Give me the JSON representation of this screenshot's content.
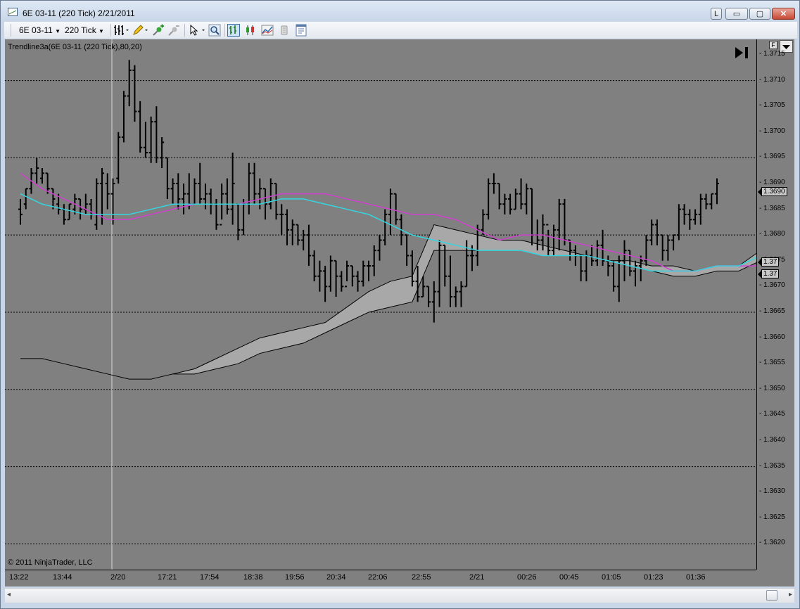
{
  "window": {
    "title": "6E 03-11 (220 Tick)  2/21/2011",
    "link_button": "L",
    "minimize_glyph": "▭",
    "maximize_glyph": "▢",
    "close_glyph": "✕"
  },
  "toolbar": {
    "instrument": "6E 03-11",
    "interval": "220 Tick",
    "icons": [
      "bars-style-icon",
      "pencil-draw-icon",
      "add-indicator-icon",
      "remove-indicator-icon",
      "cursor-icon",
      "zoom-icon",
      "bar-chart-icon",
      "candlestick-icon",
      "line-chart-icon",
      "data-box-icon",
      "properties-icon"
    ]
  },
  "chart": {
    "indicator_label": "Trendline3a(6E 03-11 (220 Tick),80,20)",
    "copyright": "© 2011 NinjaTrader, LLC",
    "f_button": "F",
    "colors": {
      "background": "#808080",
      "cyan": "#33d6e0",
      "magenta": "#d040d0",
      "cloud": "#a8a8a8"
    },
    "price_tags": [
      "1.3690",
      "1.37",
      "1.37"
    ]
  },
  "chart_data": {
    "type": "line",
    "ylim": [
      1.3615,
      1.3718
    ],
    "y_ticks": [
      "1.3715",
      "1.3710",
      "1.3705",
      "1.3700",
      "1.3695",
      "1.3690",
      "1.3685",
      "1.3680",
      "1.3675",
      "1.3670",
      "1.3665",
      "1.3660",
      "1.3655",
      "1.3650",
      "1.3645",
      "1.3640",
      "1.3635",
      "1.3630",
      "1.3625",
      "1.3620"
    ],
    "x_ticks": [
      "13:22",
      "13:44",
      "2/20",
      "17:21",
      "17:54",
      "18:38",
      "19:56",
      "20:34",
      "22:06",
      "22:55",
      "2/21",
      "00:26",
      "00:45",
      "01:05",
      "01:23",
      "01:36"
    ],
    "grid_lines": [
      1.371,
      1.3695,
      1.368,
      1.3665,
      1.365,
      1.3635,
      1.362
    ],
    "bars": [
      [
        1.3687,
        1.3682,
        1.3685,
        1.3684
      ],
      [
        1.3689,
        1.3685,
        1.3686,
        1.3689
      ],
      [
        1.3693,
        1.3688,
        1.3689,
        1.3692
      ],
      [
        1.3695,
        1.369,
        1.3692,
        1.3693
      ],
      [
        1.3693,
        1.369,
        1.3691,
        1.3692
      ],
      [
        1.3692,
        1.3688,
        1.3692,
        1.3689
      ],
      [
        1.3689,
        1.3685,
        1.3689,
        1.3687
      ],
      [
        1.3688,
        1.3684,
        1.3686,
        1.3685
      ],
      [
        1.3686,
        1.3682,
        1.3685,
        1.3683
      ],
      [
        1.3686,
        1.3683,
        1.3683,
        1.3686
      ],
      [
        1.3688,
        1.3684,
        1.3685,
        1.3687
      ],
      [
        1.3687,
        1.3683,
        1.3687,
        1.3685
      ],
      [
        1.3688,
        1.3684,
        1.3685,
        1.3686
      ],
      [
        1.3687,
        1.3683,
        1.3686,
        1.3684
      ],
      [
        1.3691,
        1.3681,
        1.3682,
        1.369
      ],
      [
        1.3693,
        1.3682,
        1.369,
        1.3692
      ],
      [
        1.3692,
        1.3685,
        1.369,
        1.3688
      ],
      [
        1.3691,
        1.3682,
        1.3688,
        1.369
      ],
      [
        1.37,
        1.369,
        1.3691,
        1.3699
      ],
      [
        1.3708,
        1.3698,
        1.3699,
        1.3707
      ],
      [
        1.3714,
        1.3705,
        1.3707,
        1.3712
      ],
      [
        1.3713,
        1.3702,
        1.3712,
        1.3704
      ],
      [
        1.3706,
        1.3696,
        1.3704,
        1.3697
      ],
      [
        1.3702,
        1.3695,
        1.3697,
        1.3696
      ],
      [
        1.3703,
        1.3694,
        1.3696,
        1.3702
      ],
      [
        1.3705,
        1.3694,
        1.3702,
        1.3695
      ],
      [
        1.3699,
        1.3693,
        1.3695,
        1.3698
      ],
      [
        1.3695,
        1.3687,
        1.3695,
        1.3689
      ],
      [
        1.3691,
        1.3686,
        1.3689,
        1.369
      ],
      [
        1.3692,
        1.3685,
        1.369,
        1.3687
      ],
      [
        1.369,
        1.3684,
        1.3687,
        1.3688
      ],
      [
        1.3692,
        1.3685,
        1.3688,
        1.3686
      ],
      [
        1.3691,
        1.3686,
        1.3686,
        1.369
      ],
      [
        1.3694,
        1.3686,
        1.369,
        1.3687
      ],
      [
        1.369,
        1.3685,
        1.3687,
        1.3688
      ],
      [
        1.3689,
        1.3684,
        1.3688,
        1.3686
      ],
      [
        1.3687,
        1.3681,
        1.3686,
        1.3682
      ],
      [
        1.369,
        1.3683,
        1.3682,
        1.3688
      ],
      [
        1.3691,
        1.3684,
        1.3688,
        1.3685
      ],
      [
        1.3696,
        1.3682,
        1.3685,
        1.369
      ],
      [
        1.3686,
        1.3679,
        1.3686,
        1.3681
      ],
      [
        1.3687,
        1.368,
        1.3681,
        1.3686
      ],
      [
        1.3694,
        1.3684,
        1.3686,
        1.3692
      ],
      [
        1.3694,
        1.3686,
        1.3692,
        1.3688
      ],
      [
        1.3691,
        1.3685,
        1.3688,
        1.3689
      ],
      [
        1.3689,
        1.3683,
        1.3689,
        1.3686
      ],
      [
        1.3691,
        1.3685,
        1.3686,
        1.369
      ],
      [
        1.369,
        1.3683,
        1.369,
        1.3684
      ],
      [
        1.3686,
        1.368,
        1.3684,
        1.3684
      ],
      [
        1.3685,
        1.3678,
        1.3684,
        1.3681
      ],
      [
        1.3683,
        1.3678,
        1.3681,
        1.3682
      ],
      [
        1.3682,
        1.3678,
        1.3682,
        1.3679
      ],
      [
        1.3681,
        1.3677,
        1.3679,
        1.368
      ],
      [
        1.3682,
        1.3674,
        1.368,
        1.3676
      ],
      [
        1.3677,
        1.3671,
        1.3676,
        1.3672
      ],
      [
        1.3675,
        1.3669,
        1.3672,
        1.3673
      ],
      [
        1.3674,
        1.3667,
        1.3673,
        1.367
      ],
      [
        1.3676,
        1.3669,
        1.367,
        1.3675
      ],
      [
        1.3675,
        1.3668,
        1.3675,
        1.3672
      ],
      [
        1.3673,
        1.3669,
        1.3672,
        1.367
      ],
      [
        1.3675,
        1.3671,
        1.367,
        1.3674
      ],
      [
        1.3674,
        1.367,
        1.3674,
        1.3672
      ],
      [
        1.3673,
        1.3669,
        1.3672,
        1.3671
      ],
      [
        1.3675,
        1.367,
        1.3671,
        1.3674
      ],
      [
        1.3675,
        1.3671,
        1.3674,
        1.3674
      ],
      [
        1.3678,
        1.3672,
        1.3674,
        1.3677
      ],
      [
        1.368,
        1.3675,
        1.3677,
        1.3679
      ],
      [
        1.3685,
        1.3678,
        1.3679,
        1.3684
      ],
      [
        1.3689,
        1.368,
        1.3684,
        1.3688
      ],
      [
        1.3688,
        1.3682,
        1.3688,
        1.3683
      ],
      [
        1.3684,
        1.3678,
        1.3683,
        1.368
      ],
      [
        1.368,
        1.3674,
        1.368,
        1.3676
      ],
      [
        1.3677,
        1.367,
        1.3676,
        1.3671
      ],
      [
        1.3674,
        1.3667,
        1.3671,
        1.3668
      ],
      [
        1.3672,
        1.3668,
        1.3668,
        1.367
      ],
      [
        1.367,
        1.3666,
        1.367,
        1.3667
      ],
      [
        1.3671,
        1.3663,
        1.3667,
        1.3669
      ],
      [
        1.3679,
        1.3666,
        1.3669,
        1.3678
      ],
      [
        1.3678,
        1.367,
        1.3678,
        1.3672
      ],
      [
        1.3676,
        1.3666,
        1.3672,
        1.3668
      ],
      [
        1.367,
        1.3666,
        1.3668,
        1.3669
      ],
      [
        1.3671,
        1.3666,
        1.3669,
        1.367
      ],
      [
        1.3679,
        1.367,
        1.367,
        1.3676
      ],
      [
        1.3678,
        1.3673,
        1.3676,
        1.3676
      ],
      [
        1.3682,
        1.3674,
        1.3676,
        1.3681
      ],
      [
        1.3685,
        1.368,
        1.3681,
        1.3684
      ],
      [
        1.3691,
        1.3683,
        1.3684,
        1.369
      ],
      [
        1.3692,
        1.3688,
        1.369,
        1.369
      ],
      [
        1.369,
        1.3685,
        1.369,
        1.3686
      ],
      [
        1.3688,
        1.3684,
        1.3686,
        1.3687
      ],
      [
        1.3688,
        1.3684,
        1.3687,
        1.3685
      ],
      [
        1.3689,
        1.3685,
        1.3685,
        1.3688
      ],
      [
        1.3691,
        1.3685,
        1.3688,
        1.3686
      ],
      [
        1.369,
        1.3684,
        1.3686,
        1.3689
      ],
      [
        1.3689,
        1.3678,
        1.3689,
        1.368
      ],
      [
        1.3683,
        1.3677,
        1.368,
        1.3679
      ],
      [
        1.3684,
        1.3677,
        1.3679,
        1.3682
      ],
      [
        1.3681,
        1.3676,
        1.3682,
        1.3677
      ],
      [
        1.3682,
        1.3676,
        1.3677,
        1.3681
      ],
      [
        1.3687,
        1.3677,
        1.3681,
        1.3686
      ],
      [
        1.3687,
        1.3678,
        1.3686,
        1.3679
      ],
      [
        1.3679,
        1.3675,
        1.3679,
        1.3677
      ],
      [
        1.3678,
        1.3674,
        1.3677,
        1.3676
      ],
      [
        1.3676,
        1.3671,
        1.3676,
        1.3673
      ],
      [
        1.3677,
        1.3671,
        1.3673,
        1.3676
      ],
      [
        1.3678,
        1.3674,
        1.3676,
        1.3675
      ],
      [
        1.3679,
        1.3674,
        1.3675,
        1.3678
      ],
      [
        1.3681,
        1.3674,
        1.3678,
        1.3675
      ],
      [
        1.3676,
        1.3672,
        1.3675,
        1.3674
      ],
      [
        1.3675,
        1.3669,
        1.3674,
        1.367
      ],
      [
        1.3676,
        1.3667,
        1.367,
        1.3675
      ],
      [
        1.3679,
        1.3671,
        1.3675,
        1.3677
      ],
      [
        1.3677,
        1.3672,
        1.3677,
        1.3673
      ],
      [
        1.3675,
        1.367,
        1.3673,
        1.3674
      ],
      [
        1.3676,
        1.3671,
        1.3674,
        1.3675
      ],
      [
        1.368,
        1.3674,
        1.3675,
        1.3679
      ],
      [
        1.3683,
        1.3678,
        1.3679,
        1.3682
      ],
      [
        1.3683,
        1.3678,
        1.3682,
        1.368
      ],
      [
        1.368,
        1.3675,
        1.368,
        1.3677
      ],
      [
        1.368,
        1.3675,
        1.3677,
        1.3679
      ],
      [
        1.368,
        1.3677,
        1.3679,
        1.368
      ],
      [
        1.3686,
        1.3679,
        1.368,
        1.3685
      ],
      [
        1.3686,
        1.3682,
        1.3685,
        1.3684
      ],
      [
        1.3685,
        1.3681,
        1.3684,
        1.3683
      ],
      [
        1.3685,
        1.3682,
        1.3683,
        1.3684
      ],
      [
        1.3688,
        1.3682,
        1.3684,
        1.3687
      ],
      [
        1.3688,
        1.3685,
        1.3687,
        1.3686
      ],
      [
        1.3688,
        1.3685,
        1.3686,
        1.3688
      ],
      [
        1.3691,
        1.3686,
        1.3688,
        1.369
      ]
    ],
    "series": [
      {
        "color": "magenta",
        "x": [
          0,
          4,
          8,
          12,
          16,
          20,
          24,
          28,
          32,
          36,
          40,
          44,
          48,
          52,
          56,
          60,
          64,
          68,
          72,
          76,
          80,
          84,
          88,
          92,
          96,
          100,
          104,
          108,
          112,
          116,
          120,
          124,
          128,
          132,
          136
        ],
        "y": [
          1.3692,
          1.3689,
          1.3687,
          1.3685,
          1.3683,
          1.3683,
          1.3684,
          1.3685,
          1.3686,
          1.3686,
          1.3686,
          1.3687,
          1.3688,
          1.3688,
          1.3688,
          1.3687,
          1.3686,
          1.3685,
          1.3684,
          1.3684,
          1.3683,
          1.3681,
          1.3679,
          1.368,
          1.368,
          1.3679,
          1.3678,
          1.3677,
          1.3676,
          1.3675,
          1.3673,
          1.3673,
          1.3674,
          1.3674,
          1.3674
        ]
      },
      {
        "color": "cyan",
        "x": [
          0,
          4,
          8,
          12,
          16,
          20,
          24,
          28,
          32,
          36,
          40,
          44,
          48,
          52,
          56,
          60,
          64,
          68,
          72,
          76,
          80,
          84,
          88,
          92,
          96,
          100,
          104,
          108,
          112,
          116,
          120,
          124,
          128,
          132,
          136
        ],
        "y": [
          1.3688,
          1.3686,
          1.3685,
          1.3684,
          1.3684,
          1.3684,
          1.3685,
          1.3686,
          1.3686,
          1.3686,
          1.3686,
          1.3686,
          1.3687,
          1.3687,
          1.3686,
          1.3685,
          1.3684,
          1.3682,
          1.368,
          1.3679,
          1.3678,
          1.3677,
          1.3677,
          1.3677,
          1.3676,
          1.3676,
          1.3676,
          1.3675,
          1.3674,
          1.3673,
          1.3673,
          1.3673,
          1.3674,
          1.3674,
          1.3676
        ]
      }
    ],
    "cloud_upper": [
      1.3656,
      1.3656,
      1.3655,
      1.3654,
      1.3653,
      1.3652,
      1.3652,
      1.3653,
      1.3654,
      1.3656,
      1.3658,
      1.366,
      1.3661,
      1.3662,
      1.3663,
      1.3666,
      1.3669,
      1.3671,
      1.3672,
      1.3682,
      1.3681,
      1.368,
      1.3679,
      1.3679,
      1.3678,
      1.3677,
      1.3676,
      1.3675,
      1.3675,
      1.3674,
      1.3674,
      1.3673,
      1.3674,
      1.3674,
      1.3677
    ],
    "cloud_lower": [
      1.3656,
      1.3656,
      1.3655,
      1.3654,
      1.3653,
      1.3652,
      1.3652,
      1.3653,
      1.3653,
      1.3654,
      1.3655,
      1.3657,
      1.3658,
      1.3659,
      1.3661,
      1.3663,
      1.3665,
      1.3666,
      1.3667,
      1.3677,
      1.3677,
      1.3677,
      1.3677,
      1.3677,
      1.3676,
      1.3676,
      1.3676,
      1.3675,
      1.3674,
      1.3673,
      1.3672,
      1.3672,
      1.3673,
      1.3673,
      1.3675
    ]
  },
  "scrollbar": {
    "left_glyph": "◂",
    "right_glyph": "▸"
  }
}
